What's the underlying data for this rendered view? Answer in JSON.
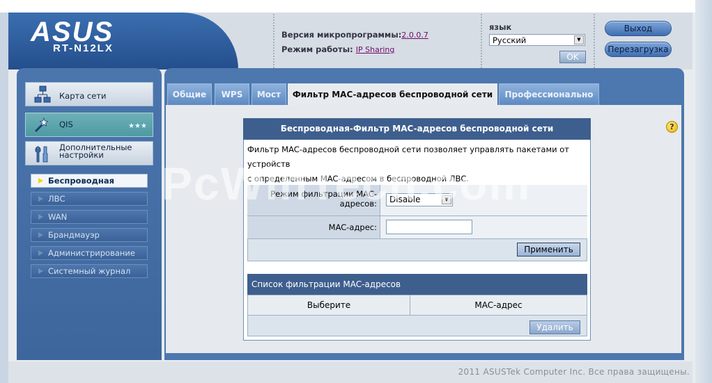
{
  "header": {
    "brand": "ASUS",
    "model": "RT-N12LX",
    "firmware_label": "Версия микропрограммы:",
    "firmware_value": "2.0.0.7",
    "mode_label": "Режим работы:",
    "mode_value": "IP Sharing",
    "language_label": "язык",
    "language_value": "Русский",
    "ok_label": "OK",
    "logout_label": "Выход",
    "reboot_label": "Перезагрузка"
  },
  "sidebar": {
    "main_items": [
      {
        "label": "Карта сети",
        "icon": "network-map-icon"
      },
      {
        "label": "QIS",
        "icon": "magic-wand-icon"
      },
      {
        "label": "Дополнительные настройки",
        "icon": "tools-icon"
      }
    ],
    "sub_items": [
      {
        "label": "Беспроводная",
        "active": true
      },
      {
        "label": "ЛВС",
        "active": false
      },
      {
        "label": "WAN",
        "active": false
      },
      {
        "label": "Брандмауэр",
        "active": false
      },
      {
        "label": "Администрирование",
        "active": false
      },
      {
        "label": "Системный журнал",
        "active": false
      }
    ]
  },
  "tabs": [
    {
      "label": "Общие"
    },
    {
      "label": "WPS"
    },
    {
      "label": "Мост"
    },
    {
      "label": "Фильтр MAC-адресов беспроводной сети"
    },
    {
      "label": "Профессионально"
    }
  ],
  "panel": {
    "title": "Беспроводная-Фильтр MAC-адресов беспроводной сети",
    "description_line1": "Фильтр MAC-адресов беспроводной сети позволяет управлять пакетами от устройств",
    "description_line2": "с определенным MAC-адресом в беспроводной ЛВС.",
    "mode_label_line1": "Режим фильтрации MAC-",
    "mode_label_line2": "адресов:",
    "mode_value": "Disable",
    "mac_label": "MAC-адрес:",
    "mac_value": "",
    "apply_label": "Применить",
    "list_title": "Список фильтрации MAC-адресов",
    "col_select": "Выберите",
    "col_mac": "MAC-адрес",
    "delete_label": "Удалить"
  },
  "footer": {
    "copyright": "2011 ASUSTek Computer Inc. Все права защищены."
  },
  "watermark": "PcWinTech.com",
  "colors": {
    "accent": "#3e5f8e",
    "sidebar": "#4b76ad",
    "active_arrow": "#f5d400"
  }
}
